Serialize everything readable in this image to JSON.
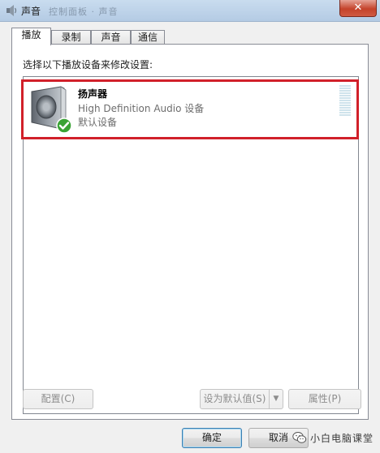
{
  "window": {
    "title": "声音",
    "close_label": "✕",
    "background_text": "控制面板 · 声音"
  },
  "tabs": [
    {
      "label": "播放",
      "active": true
    },
    {
      "label": "录制",
      "active": false
    },
    {
      "label": "声音",
      "active": false
    },
    {
      "label": "通信",
      "active": false
    }
  ],
  "playback": {
    "instruction": "选择以下播放设备来修改设置:",
    "devices": [
      {
        "name": "扬声器",
        "description": "High Definition Audio 设备",
        "status": "默认设备",
        "default_check": true
      }
    ]
  },
  "buttons": {
    "configure": "配置(C)",
    "set_default": "设为默认值(S)",
    "properties": "属性(P)",
    "ok": "确定",
    "cancel": "取消"
  },
  "watermark": {
    "text": "小白电脑课堂"
  },
  "colors": {
    "highlight_border": "#d1202a",
    "check_green": "#3aa335",
    "title_bar": "#c9dcef",
    "close_red": "#c4432b"
  }
}
